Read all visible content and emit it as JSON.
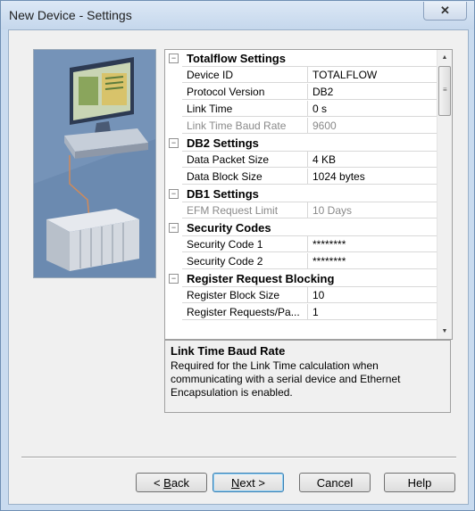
{
  "window": {
    "title": "New Device - Settings",
    "close_glyph": "✕"
  },
  "property_grid": {
    "rows": [
      {
        "kind": "category",
        "label": "Totalflow Settings"
      },
      {
        "kind": "property",
        "name": "Device ID",
        "value": "TOTALFLOW",
        "disabled": false
      },
      {
        "kind": "property",
        "name": "Protocol Version",
        "value": "DB2",
        "disabled": false
      },
      {
        "kind": "property",
        "name": "Link Time",
        "value": "0 s",
        "disabled": false
      },
      {
        "kind": "property",
        "name": "Link Time Baud Rate",
        "value": "9600",
        "disabled": true
      },
      {
        "kind": "category",
        "label": "DB2 Settings"
      },
      {
        "kind": "property",
        "name": "Data Packet Size",
        "value": "4 KB",
        "disabled": false
      },
      {
        "kind": "property",
        "name": "Data Block Size",
        "value": "1024 bytes",
        "disabled": false
      },
      {
        "kind": "category",
        "label": "DB1 Settings"
      },
      {
        "kind": "property",
        "name": "EFM Request Limit",
        "value": "10 Days",
        "disabled": true
      },
      {
        "kind": "category",
        "label": "Security Codes"
      },
      {
        "kind": "property",
        "name": "Security Code 1",
        "value": "********",
        "disabled": false
      },
      {
        "kind": "property",
        "name": "Security Code 2",
        "value": "********",
        "disabled": false
      },
      {
        "kind": "category",
        "label": "Register Request Blocking"
      },
      {
        "kind": "property",
        "name": "Register Block Size",
        "value": "10",
        "disabled": false
      },
      {
        "kind": "property",
        "name": "Register Requests/Pa...",
        "value": "1",
        "disabled": false
      }
    ],
    "collapse_glyph": "−"
  },
  "description": {
    "title": "Link Time Baud Rate",
    "body": "Required for the Link Time calculation when communicating with a serial device and Ethernet Encapsulation is enabled."
  },
  "buttons": {
    "back_prefix": "< ",
    "back_mnemonic": "B",
    "back_rest": "ack",
    "next_mnemonic": "N",
    "next_rest": "ext >",
    "cancel": "Cancel",
    "help": "Help"
  },
  "colors": {
    "picture_bg": "#6b8ab0",
    "default_button_border": "#3c7fb1"
  }
}
